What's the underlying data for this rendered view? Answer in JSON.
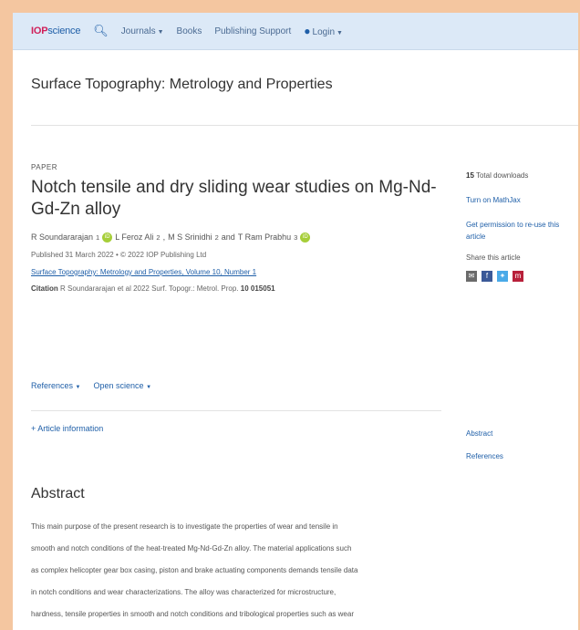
{
  "navbar": {
    "logo_prefix": "IOP",
    "logo_suffix": "science",
    "items": [
      {
        "label": "Journals",
        "caret": true
      },
      {
        "label": "Books",
        "caret": false
      },
      {
        "label": "Publishing Support",
        "caret": false
      }
    ],
    "login_label": "Login"
  },
  "journal_title": "Surface Topography: Metrology and Properties",
  "article": {
    "type_label": "PAPER",
    "title": "Notch tensile and dry sliding wear studies on Mg-Nd-Gd-Zn alloy",
    "authors": {
      "a1": "R Soundararajan",
      "a1_sup": "1",
      "a2": "L Feroz Ali",
      "a2_sup": "2",
      "a3": "M S Srinidhi",
      "a3_sup": "2",
      "and": "and",
      "a4": "T Ram Prabhu",
      "a4_sup": "3"
    },
    "published": "Published 31 March 2022 • © 2022 IOP Publishing Ltd",
    "volume_link": "Surface Topography: Metrology and Properties, Volume 10, Number 1",
    "citation_label": "Citation",
    "citation_text": "R Soundararajan et al 2022 Surf. Topogr.: Metrol. Prop.",
    "citation_id": "10 015051"
  },
  "dropdowns": {
    "references": "References",
    "open_science": "Open science"
  },
  "article_info": "Article information",
  "abstract": {
    "heading": "Abstract",
    "lines": [
      "This main purpose of the present research is to investigate the properties of wear and tensile in",
      "smooth and notch conditions of the heat-treated Mg-Nd-Gd-Zn alloy. The material applications such",
      "as complex helicopter gear box casing, piston and brake actuating components demands tensile data",
      "in notch conditions and wear characterizations. The alloy was characterized for microstructure,",
      "hardness, tensile properties in smooth and notch conditions and tribological properties such as wear"
    ]
  },
  "sidebar": {
    "downloads_count": "15",
    "downloads_label": "Total downloads",
    "mathjax": "Turn on MathJax",
    "permission": "Get permission to re-use this article",
    "share_label": "Share this article",
    "nav_abstract": "Abstract",
    "nav_references": "References"
  },
  "colors": {
    "iop_red": "#d0205a",
    "link_blue": "#1f5fa8",
    "orcid_green": "#a6ce39",
    "frame_bg": "#f4c6a0",
    "navbar_bg": "#dce9f7",
    "share_email": "#6b6b6b",
    "share_facebook": "#3b5998",
    "share_twitter": "#4aaae8",
    "share_mendeley": "#b8203a"
  }
}
